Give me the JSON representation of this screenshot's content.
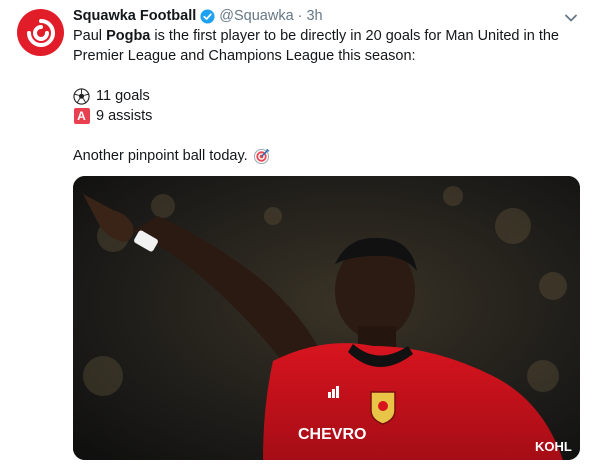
{
  "tweet": {
    "author_name": "Squawka Football",
    "handle": "@Squawka",
    "separator": "·",
    "time": "3h",
    "text_line1_prefix": "Paul ",
    "text_line1_bold": "Pogba",
    "text_line1_suffix": " is the first player to be directly in 20 goals for Man United in the Premier League and Champions League this season:",
    "goals_text": "11 goals",
    "assists_text": "9 assists",
    "assists_badge": "A",
    "closing_text": "Another pinpoint ball today.",
    "image_alt_sponsor": "KOHL",
    "image_alt_sponsor2": "CHEVRO"
  },
  "icons": {
    "avatar": "squawka-logo-icon",
    "verified": "verified-badge-icon",
    "menu": "chevron-down-icon",
    "goals": "soccer-ball-icon",
    "assists": "letter-a-icon",
    "target": "direct-hit-icon"
  },
  "colors": {
    "brand_red": "#e11d2a",
    "verified_blue": "#1da1f2",
    "muted": "#657786",
    "text": "#14171a"
  }
}
